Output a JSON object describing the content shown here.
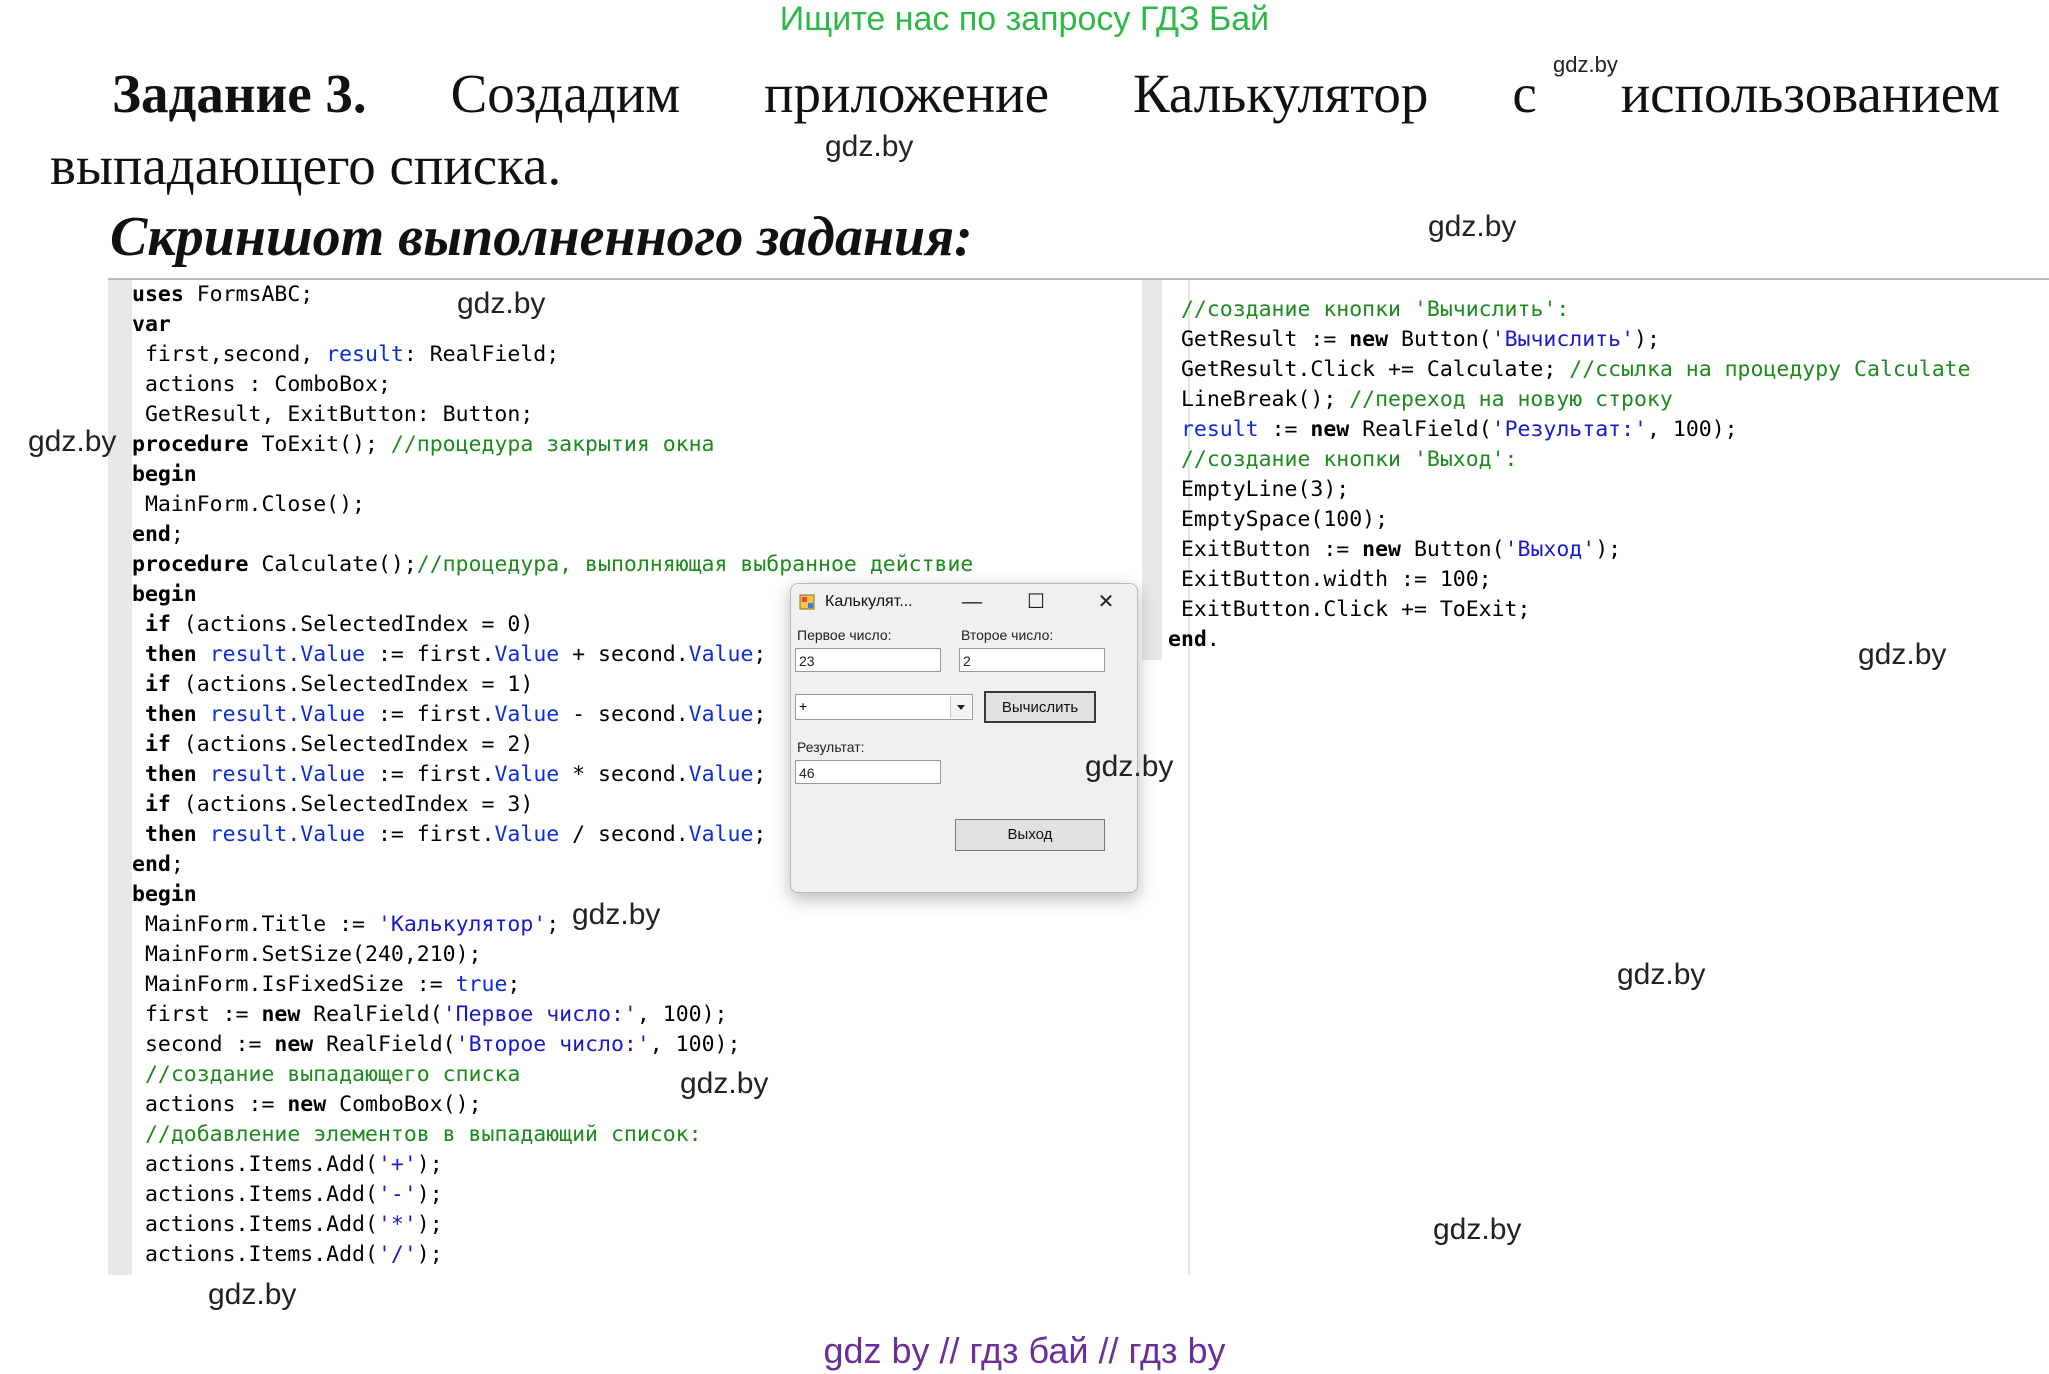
{
  "top_note": "Ищите нас по запросу ГДЗ Бай",
  "heading": {
    "task_label": "Задание 3.",
    "task_words": [
      "Создадим",
      "приложение",
      "Калькулятор",
      "с",
      "использованием"
    ],
    "task_line2": "выпадающего списка."
  },
  "subheading": "Скриншот выполненного задания:",
  "watermark": "gdz.by",
  "footer": "gdz by  //  гдз бай  //  гдз by",
  "code_left": [
    [
      [
        "kw",
        "uses"
      ],
      [
        "t",
        " FormsABC;"
      ]
    ],
    [
      [
        "kw",
        "var"
      ]
    ],
    [
      [
        "t",
        " first,second, "
      ],
      [
        "id",
        "result"
      ],
      [
        "t",
        ": RealField;"
      ]
    ],
    [
      [
        "t",
        " actions : ComboBox;"
      ]
    ],
    [
      [
        "t",
        " GetResult, ExitButton: Button;"
      ]
    ],
    [
      [
        "kw",
        "procedure"
      ],
      [
        "t",
        " ToExit(); "
      ],
      [
        "cm",
        "//процедура закрытия окна"
      ]
    ],
    [
      [
        "kw",
        "begin"
      ]
    ],
    [
      [
        "t",
        " MainForm.Close();"
      ]
    ],
    [
      [
        "kw",
        "end"
      ],
      [
        "t",
        ";"
      ]
    ],
    [
      [
        "kw",
        "procedure"
      ],
      [
        "t",
        " Calculate();"
      ],
      [
        "cm",
        "//процедура, выполняющая выбранное действие"
      ]
    ],
    [
      [
        "kw",
        "begin"
      ]
    ],
    [
      [
        "t",
        " "
      ],
      [
        "kw",
        "if"
      ],
      [
        "t",
        " (actions.SelectedIndex = 0)"
      ]
    ],
    [
      [
        "t",
        " "
      ],
      [
        "kw",
        "then"
      ],
      [
        "t",
        " "
      ],
      [
        "id",
        "result.Value"
      ],
      [
        "t",
        " := first."
      ],
      [
        "id",
        "Value"
      ],
      [
        "t",
        " + second."
      ],
      [
        "id",
        "Value"
      ],
      [
        "t",
        ";"
      ]
    ],
    [
      [
        "t",
        " "
      ],
      [
        "kw",
        "if"
      ],
      [
        "t",
        " (actions.SelectedIndex = 1)"
      ]
    ],
    [
      [
        "t",
        " "
      ],
      [
        "kw",
        "then"
      ],
      [
        "t",
        " "
      ],
      [
        "id",
        "result.Value"
      ],
      [
        "t",
        " := first."
      ],
      [
        "id",
        "Value"
      ],
      [
        "t",
        " - second."
      ],
      [
        "id",
        "Value"
      ],
      [
        "t",
        ";"
      ]
    ],
    [
      [
        "t",
        " "
      ],
      [
        "kw",
        "if"
      ],
      [
        "t",
        " (actions.SelectedIndex = 2)"
      ]
    ],
    [
      [
        "t",
        " "
      ],
      [
        "kw",
        "then"
      ],
      [
        "t",
        " "
      ],
      [
        "id",
        "result.Value"
      ],
      [
        "t",
        " := first."
      ],
      [
        "id",
        "Value"
      ],
      [
        "t",
        " * second."
      ],
      [
        "id",
        "Value"
      ],
      [
        "t",
        ";"
      ]
    ],
    [
      [
        "t",
        " "
      ],
      [
        "kw",
        "if"
      ],
      [
        "t",
        " (actions.SelectedIndex = 3)"
      ]
    ],
    [
      [
        "t",
        " "
      ],
      [
        "kw",
        "then"
      ],
      [
        "t",
        " "
      ],
      [
        "id",
        "result.Value"
      ],
      [
        "t",
        " := first."
      ],
      [
        "id",
        "Value"
      ],
      [
        "t",
        " / second."
      ],
      [
        "id",
        "Value"
      ],
      [
        "t",
        ";"
      ]
    ],
    [
      [
        "kw",
        "end"
      ],
      [
        "t",
        ";"
      ]
    ],
    [
      [
        "kw",
        "begin"
      ]
    ],
    [
      [
        "t",
        " MainForm.Title := "
      ],
      [
        "str",
        "'Калькулятор'"
      ],
      [
        "t",
        ";"
      ]
    ],
    [
      [
        "t",
        " MainForm.SetSize(240,210);"
      ]
    ],
    [
      [
        "t",
        " MainForm.IsFixedSize := "
      ],
      [
        "id",
        "true"
      ],
      [
        "t",
        ";"
      ]
    ],
    [
      [
        "t",
        " first := "
      ],
      [
        "kw",
        "new"
      ],
      [
        "t",
        " RealField("
      ],
      [
        "str",
        "'Первое число:'"
      ],
      [
        "t",
        ", 100);"
      ]
    ],
    [
      [
        "t",
        " second := "
      ],
      [
        "kw",
        "new"
      ],
      [
        "t",
        " RealField("
      ],
      [
        "str",
        "'Второе число:'"
      ],
      [
        "t",
        ", 100);"
      ]
    ],
    [
      [
        "t",
        " "
      ],
      [
        "cm",
        "//создание выпадающего списка"
      ]
    ],
    [
      [
        "t",
        " actions := "
      ],
      [
        "kw",
        "new"
      ],
      [
        "t",
        " ComboBox();"
      ]
    ],
    [
      [
        "t",
        " "
      ],
      [
        "cm",
        "//добавление элементов в выпадающий список:"
      ]
    ],
    [
      [
        "t",
        " actions.Items.Add("
      ],
      [
        "str",
        "'+'"
      ],
      [
        "t",
        ");"
      ]
    ],
    [
      [
        "t",
        " actions.Items.Add("
      ],
      [
        "str",
        "'-'"
      ],
      [
        "t",
        ");"
      ]
    ],
    [
      [
        "t",
        " actions.Items.Add("
      ],
      [
        "str",
        "'*'"
      ],
      [
        "t",
        ");"
      ]
    ],
    [
      [
        "t",
        " actions.Items.Add("
      ],
      [
        "str",
        "'/'"
      ],
      [
        "t",
        ");"
      ]
    ]
  ],
  "code_right": [
    [
      [
        "t",
        " "
      ],
      [
        "cm",
        "//создание кнопки 'Вычислить':"
      ]
    ],
    [
      [
        "t",
        " GetResult := "
      ],
      [
        "kw",
        "new"
      ],
      [
        "t",
        " Button("
      ],
      [
        "str",
        "'Вычислить'"
      ],
      [
        "t",
        ");"
      ]
    ],
    [
      [
        "t",
        " GetResult.Click += Calculate; "
      ],
      [
        "cm",
        "//ссылка на процедуру Calculate"
      ]
    ],
    [
      [
        "t",
        " LineBreak(); "
      ],
      [
        "cm",
        "//переход на новую строку"
      ]
    ],
    [
      [
        "t",
        " "
      ],
      [
        "id",
        "result"
      ],
      [
        "t",
        " := "
      ],
      [
        "kw",
        "new"
      ],
      [
        "t",
        " RealField("
      ],
      [
        "str",
        "'Результат:'"
      ],
      [
        "t",
        ", 100);"
      ]
    ],
    [
      [
        "t",
        " "
      ],
      [
        "cm",
        "//создание кнопки 'Выход':"
      ]
    ],
    [
      [
        "t",
        " EmptyLine(3);"
      ]
    ],
    [
      [
        "t",
        " EmptySpace(100);"
      ]
    ],
    [
      [
        "t",
        " ExitButton := "
      ],
      [
        "kw",
        "new"
      ],
      [
        "t",
        " Button("
      ],
      [
        "str",
        "'Выход'"
      ],
      [
        "t",
        ");"
      ]
    ],
    [
      [
        "t",
        " ExitButton.width := 100;"
      ]
    ],
    [
      [
        "t",
        " ExitButton.Click += ToExit;"
      ]
    ],
    [
      [
        "kw",
        "end"
      ],
      [
        "t",
        "."
      ]
    ]
  ],
  "dialog": {
    "title": "Калькулят...",
    "minimize": "—",
    "maximize": "☐",
    "close": "✕",
    "first_label": "Первое число:",
    "first_value": "23",
    "second_label": "Второе число:",
    "second_value": "2",
    "combo_value": "+",
    "calc_button": "Вычислить",
    "result_label": "Результат:",
    "result_value": "46",
    "exit_button": "Выход"
  }
}
